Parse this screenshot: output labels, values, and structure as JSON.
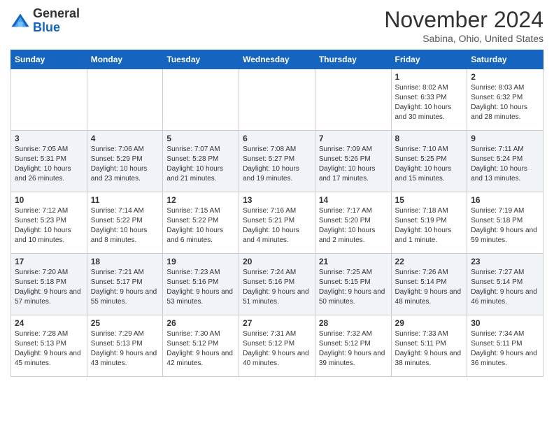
{
  "header": {
    "logo_general": "General",
    "logo_blue": "Blue",
    "month_title": "November 2024",
    "location": "Sabina, Ohio, United States"
  },
  "days_of_week": [
    "Sunday",
    "Monday",
    "Tuesday",
    "Wednesday",
    "Thursday",
    "Friday",
    "Saturday"
  ],
  "weeks": [
    [
      {
        "day": "",
        "info": ""
      },
      {
        "day": "",
        "info": ""
      },
      {
        "day": "",
        "info": ""
      },
      {
        "day": "",
        "info": ""
      },
      {
        "day": "",
        "info": ""
      },
      {
        "day": "1",
        "info": "Sunrise: 8:02 AM\nSunset: 6:33 PM\nDaylight: 10 hours and 30 minutes."
      },
      {
        "day": "2",
        "info": "Sunrise: 8:03 AM\nSunset: 6:32 PM\nDaylight: 10 hours and 28 minutes."
      }
    ],
    [
      {
        "day": "3",
        "info": "Sunrise: 7:05 AM\nSunset: 5:31 PM\nDaylight: 10 hours and 26 minutes."
      },
      {
        "day": "4",
        "info": "Sunrise: 7:06 AM\nSunset: 5:29 PM\nDaylight: 10 hours and 23 minutes."
      },
      {
        "day": "5",
        "info": "Sunrise: 7:07 AM\nSunset: 5:28 PM\nDaylight: 10 hours and 21 minutes."
      },
      {
        "day": "6",
        "info": "Sunrise: 7:08 AM\nSunset: 5:27 PM\nDaylight: 10 hours and 19 minutes."
      },
      {
        "day": "7",
        "info": "Sunrise: 7:09 AM\nSunset: 5:26 PM\nDaylight: 10 hours and 17 minutes."
      },
      {
        "day": "8",
        "info": "Sunrise: 7:10 AM\nSunset: 5:25 PM\nDaylight: 10 hours and 15 minutes."
      },
      {
        "day": "9",
        "info": "Sunrise: 7:11 AM\nSunset: 5:24 PM\nDaylight: 10 hours and 13 minutes."
      }
    ],
    [
      {
        "day": "10",
        "info": "Sunrise: 7:12 AM\nSunset: 5:23 PM\nDaylight: 10 hours and 10 minutes."
      },
      {
        "day": "11",
        "info": "Sunrise: 7:14 AM\nSunset: 5:22 PM\nDaylight: 10 hours and 8 minutes."
      },
      {
        "day": "12",
        "info": "Sunrise: 7:15 AM\nSunset: 5:22 PM\nDaylight: 10 hours and 6 minutes."
      },
      {
        "day": "13",
        "info": "Sunrise: 7:16 AM\nSunset: 5:21 PM\nDaylight: 10 hours and 4 minutes."
      },
      {
        "day": "14",
        "info": "Sunrise: 7:17 AM\nSunset: 5:20 PM\nDaylight: 10 hours and 2 minutes."
      },
      {
        "day": "15",
        "info": "Sunrise: 7:18 AM\nSunset: 5:19 PM\nDaylight: 10 hours and 1 minute."
      },
      {
        "day": "16",
        "info": "Sunrise: 7:19 AM\nSunset: 5:18 PM\nDaylight: 9 hours and 59 minutes."
      }
    ],
    [
      {
        "day": "17",
        "info": "Sunrise: 7:20 AM\nSunset: 5:18 PM\nDaylight: 9 hours and 57 minutes."
      },
      {
        "day": "18",
        "info": "Sunrise: 7:21 AM\nSunset: 5:17 PM\nDaylight: 9 hours and 55 minutes."
      },
      {
        "day": "19",
        "info": "Sunrise: 7:23 AM\nSunset: 5:16 PM\nDaylight: 9 hours and 53 minutes."
      },
      {
        "day": "20",
        "info": "Sunrise: 7:24 AM\nSunset: 5:16 PM\nDaylight: 9 hours and 51 minutes."
      },
      {
        "day": "21",
        "info": "Sunrise: 7:25 AM\nSunset: 5:15 PM\nDaylight: 9 hours and 50 minutes."
      },
      {
        "day": "22",
        "info": "Sunrise: 7:26 AM\nSunset: 5:14 PM\nDaylight: 9 hours and 48 minutes."
      },
      {
        "day": "23",
        "info": "Sunrise: 7:27 AM\nSunset: 5:14 PM\nDaylight: 9 hours and 46 minutes."
      }
    ],
    [
      {
        "day": "24",
        "info": "Sunrise: 7:28 AM\nSunset: 5:13 PM\nDaylight: 9 hours and 45 minutes."
      },
      {
        "day": "25",
        "info": "Sunrise: 7:29 AM\nSunset: 5:13 PM\nDaylight: 9 hours and 43 minutes."
      },
      {
        "day": "26",
        "info": "Sunrise: 7:30 AM\nSunset: 5:12 PM\nDaylight: 9 hours and 42 minutes."
      },
      {
        "day": "27",
        "info": "Sunrise: 7:31 AM\nSunset: 5:12 PM\nDaylight: 9 hours and 40 minutes."
      },
      {
        "day": "28",
        "info": "Sunrise: 7:32 AM\nSunset: 5:12 PM\nDaylight: 9 hours and 39 minutes."
      },
      {
        "day": "29",
        "info": "Sunrise: 7:33 AM\nSunset: 5:11 PM\nDaylight: 9 hours and 38 minutes."
      },
      {
        "day": "30",
        "info": "Sunrise: 7:34 AM\nSunset: 5:11 PM\nDaylight: 9 hours and 36 minutes."
      }
    ]
  ]
}
